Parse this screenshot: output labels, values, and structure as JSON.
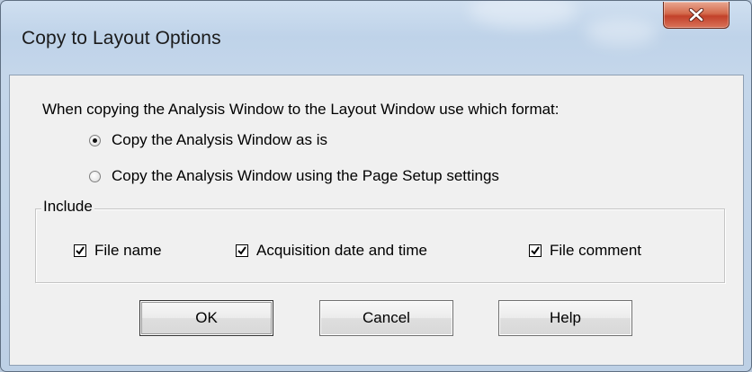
{
  "window": {
    "title": "Copy to Layout Options"
  },
  "dialog": {
    "prompt": "When copying the Analysis Window to the Layout Window use which format:",
    "format_options": [
      {
        "label": "Copy the Analysis Window as is",
        "selected": true
      },
      {
        "label": "Copy the Analysis Window using the Page Setup settings",
        "selected": false
      }
    ],
    "include_group": {
      "label": "Include",
      "items": [
        {
          "label": "File name",
          "checked": true
        },
        {
          "label": "Acquisition date and time",
          "checked": true
        },
        {
          "label": "File comment",
          "checked": true
        }
      ]
    },
    "buttons": {
      "ok": "OK",
      "cancel": "Cancel",
      "help": "Help"
    }
  },
  "colors": {
    "frame": "#c4d6ea",
    "client": "#f0f0f0",
    "close_button": "#c2412a"
  },
  "icons": {
    "close": "close-icon",
    "check": "checkmark-icon"
  }
}
